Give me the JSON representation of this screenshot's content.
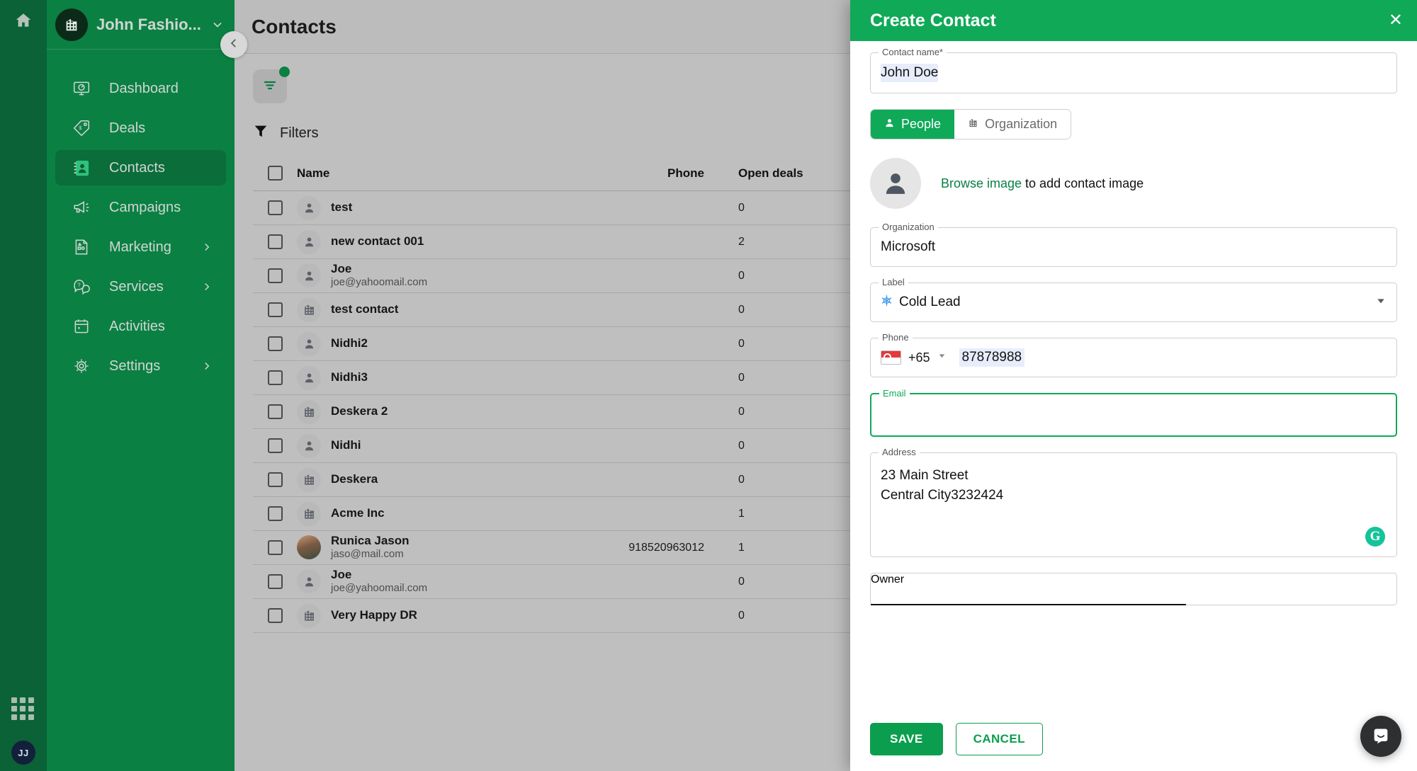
{
  "rail": {
    "home_icon": "home-icon",
    "apps_icon": "apps-grid-icon",
    "user_initials": "JJ"
  },
  "sidebar": {
    "org_name": "John Fashio...",
    "org_icon": "building-icon",
    "caret_icon": "chevron-down-icon",
    "items": [
      {
        "label": "Dashboard",
        "icon": "dashboard-icon",
        "active": false,
        "chevron": false
      },
      {
        "label": "Deals",
        "icon": "deal-tag-icon",
        "active": false,
        "chevron": false
      },
      {
        "label": "Contacts",
        "icon": "contacts-icon",
        "active": true,
        "chevron": false
      },
      {
        "label": "Campaigns",
        "icon": "megaphone-icon",
        "active": false,
        "chevron": false
      },
      {
        "label": "Marketing",
        "icon": "marketing-icon",
        "active": false,
        "chevron": true
      },
      {
        "label": "Services",
        "icon": "support-icon",
        "active": false,
        "chevron": true
      },
      {
        "label": "Activities",
        "icon": "calendar-icon",
        "active": false,
        "chevron": false
      },
      {
        "label": "Settings",
        "icon": "gear-icon",
        "active": false,
        "chevron": true
      }
    ]
  },
  "main": {
    "page_title": "Contacts",
    "collapse_icon": "chevron-left-icon",
    "filter_chip_icon": "filter-lines-icon",
    "filters_label": "Filters",
    "filters_icon": "funnel-icon",
    "table": {
      "columns": [
        "Name",
        "Phone",
        "Open deals"
      ],
      "rows": [
        {
          "name": "test",
          "sub": "",
          "phone": "",
          "deals": "0",
          "avatar": "person"
        },
        {
          "name": "new contact 001",
          "sub": "",
          "phone": "",
          "deals": "2",
          "avatar": "person"
        },
        {
          "name": "Joe",
          "sub": "joe@yahoomail.com",
          "phone": "",
          "deals": "0",
          "avatar": "person"
        },
        {
          "name": "test contact",
          "sub": "",
          "phone": "",
          "deals": "0",
          "avatar": "company"
        },
        {
          "name": "Nidhi2",
          "sub": "",
          "phone": "",
          "deals": "0",
          "avatar": "person"
        },
        {
          "name": "Nidhi3",
          "sub": "",
          "phone": "",
          "deals": "0",
          "avatar": "person"
        },
        {
          "name": "Deskera 2",
          "sub": "",
          "phone": "",
          "deals": "0",
          "avatar": "company"
        },
        {
          "name": "Nidhi",
          "sub": "",
          "phone": "",
          "deals": "0",
          "avatar": "person"
        },
        {
          "name": "Deskera",
          "sub": "",
          "phone": "",
          "deals": "0",
          "avatar": "company"
        },
        {
          "name": "Acme Inc",
          "sub": "",
          "phone": "",
          "deals": "1",
          "avatar": "company"
        },
        {
          "name": "Runica Jason",
          "sub": "jaso@mail.com",
          "phone": "918520963012",
          "deals": "1",
          "avatar": "photo"
        },
        {
          "name": "Joe",
          "sub": "joe@yahoomail.com",
          "phone": "",
          "deals": "0",
          "avatar": "person"
        },
        {
          "name": "Very Happy DR",
          "sub": "",
          "phone": "",
          "deals": "0",
          "avatar": "company"
        }
      ]
    }
  },
  "modal": {
    "title": "Create Contact",
    "close_icon": "close-icon",
    "contact_name": {
      "label": "Contact name*",
      "value": "John Doe"
    },
    "type_toggle": {
      "people_label": "People",
      "people_icon": "person-icon",
      "organization_label": "Organization",
      "organization_icon": "building-icon",
      "selected": "People"
    },
    "image": {
      "placeholder_icon": "person-avatar-icon",
      "link_text": "Browse image",
      "rest_text": " to add contact image"
    },
    "organization": {
      "label": "Organization",
      "value": "Microsoft"
    },
    "contact_label": {
      "label": "Label",
      "value": "Cold Lead",
      "value_icon": "snowflake-icon",
      "caret_icon": "caret-down-icon"
    },
    "phone": {
      "label": "Phone",
      "flag_icon": "singapore-flag-icon",
      "dial_code": "+65",
      "caret_icon": "caret-down-icon",
      "value": "87878988"
    },
    "email": {
      "label": "Email",
      "value": "",
      "focused": true
    },
    "address": {
      "label": "Address",
      "value": "23 Main Street\nCentral City3232424",
      "grammarly_icon": "grammarly-icon"
    },
    "owner": {
      "label": "Owner",
      "value": ""
    },
    "save_label": "SAVE",
    "cancel_label": "CANCEL"
  },
  "chat_widget": {
    "icon": "intercom-chat-icon"
  },
  "colors": {
    "brand_green": "#0b8043",
    "header_green": "#0fa958",
    "rail_green": "#0a6236",
    "active_nav": "#0a6d3a",
    "field_highlight": "#e7edfb",
    "grammarly": "#15c39a"
  }
}
